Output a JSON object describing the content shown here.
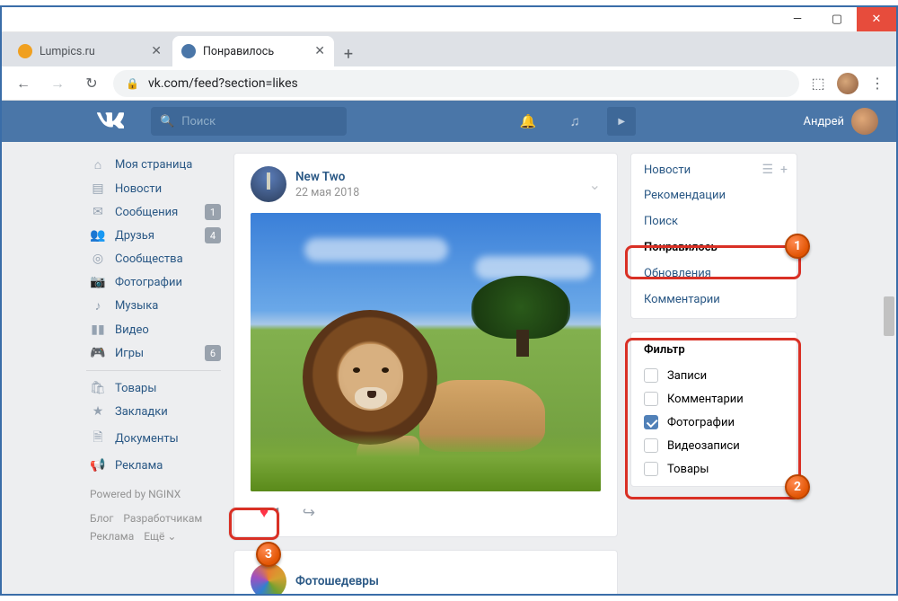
{
  "window": {
    "minimize": "—",
    "maximize": "▢",
    "close": "✕"
  },
  "browser": {
    "tabs": [
      {
        "title": "Lumpics.ru",
        "favicon": "#f0a020",
        "close": "✕"
      },
      {
        "title": "Понравилось",
        "favicon": "#4a76a8",
        "close": "✕"
      }
    ],
    "newtab": "+",
    "nav": {
      "back": "←",
      "forward": "→",
      "reload": "↻"
    },
    "lock": "🔒",
    "url": "vk.com/feed?section=likes",
    "menu": "⋮"
  },
  "vk": {
    "search_placeholder": "Поиск",
    "user_name": "Андрей",
    "icons": {
      "bell": "🔔",
      "music": "♫",
      "play": "▶"
    }
  },
  "leftnav": {
    "items": [
      {
        "icon": "⌂",
        "label": "Моя страница"
      },
      {
        "icon": "▤",
        "label": "Новости"
      },
      {
        "icon": "✉",
        "label": "Сообщения",
        "badge": "1"
      },
      {
        "icon": "👥",
        "label": "Друзья",
        "badge": "4"
      },
      {
        "icon": "◎",
        "label": "Сообщества"
      },
      {
        "icon": "📷",
        "label": "Фотографии"
      },
      {
        "icon": "♪",
        "label": "Музыка"
      },
      {
        "icon": "▮▮",
        "label": "Видео"
      },
      {
        "icon": "🎮",
        "label": "Игры",
        "badge": "6"
      }
    ],
    "items2": [
      {
        "icon": "🛍",
        "label": "Товары"
      },
      {
        "icon": "★",
        "label": "Закладки"
      },
      {
        "icon": "🗎",
        "label": "Документы"
      },
      {
        "icon": "📢",
        "label": "Реклама"
      }
    ],
    "powered": "Powered by NGINX",
    "footer": {
      "a": "Блог",
      "b": "Разработчикам",
      "c": "Реклама",
      "d": "Ещё ⌄"
    }
  },
  "post": {
    "author": "New Two",
    "date": "22 мая 2018",
    "menu": "⌄",
    "like_count": "1",
    "heart": "♥",
    "share": "↪"
  },
  "post2": {
    "author": "Фотошедевры"
  },
  "rightnav": {
    "icons": {
      "filter": "☰",
      "plus": "+"
    },
    "items": [
      {
        "label": "Новости"
      },
      {
        "label": "Рекомендации"
      },
      {
        "label": "Поиск"
      },
      {
        "label": "Понравилось",
        "active": true
      },
      {
        "label": "Обновления"
      },
      {
        "label": "Комментарии"
      }
    ],
    "filter_title": "Фильтр",
    "filters": [
      {
        "label": "Записи",
        "checked": false
      },
      {
        "label": "Комментарии",
        "checked": false
      },
      {
        "label": "Фотографии",
        "checked": true
      },
      {
        "label": "Видеозаписи",
        "checked": false
      },
      {
        "label": "Товары",
        "checked": false
      }
    ]
  },
  "annotations": {
    "one": "1",
    "two": "2",
    "three": "3"
  }
}
